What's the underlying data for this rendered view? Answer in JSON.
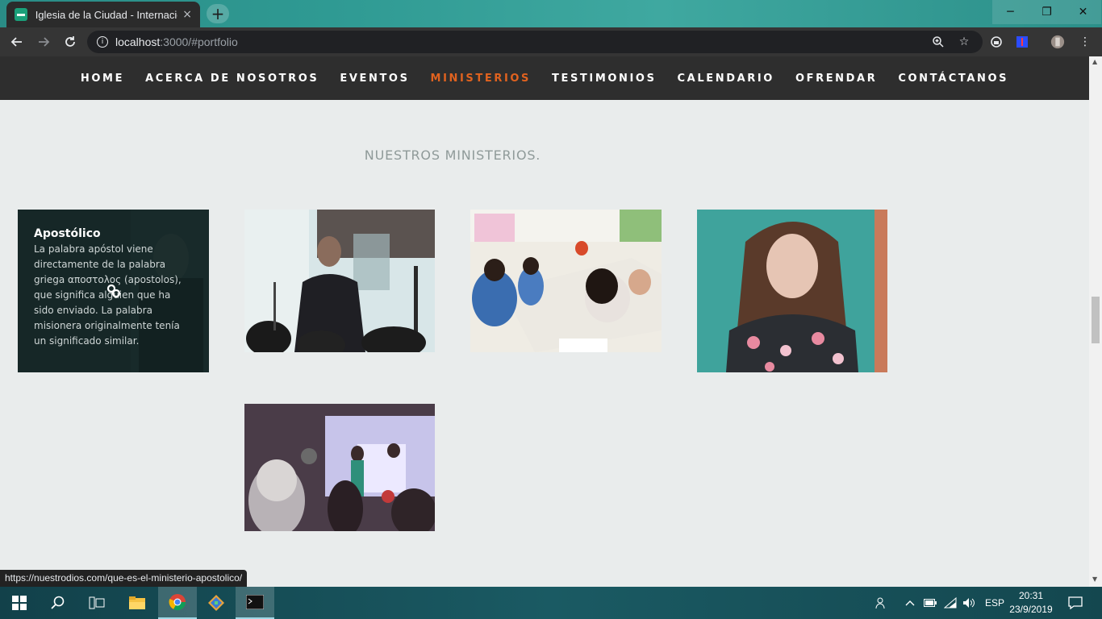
{
  "browser": {
    "tab_title": "Iglesia de la Ciudad - Internacional",
    "close_tab": "×",
    "new_tab": "+",
    "url_host": "localhost",
    "url_rest": ":3000/#portfolio",
    "status_url": "https://nuestrodios.com/que-es-el-ministerio-apostolico/",
    "window_controls": {
      "minimize": "─",
      "restore": "❐",
      "close": "✕"
    }
  },
  "nav": {
    "items": [
      {
        "label": "HOME"
      },
      {
        "label": "ACERCA DE NOSOTROS"
      },
      {
        "label": "EVENTOS"
      },
      {
        "label": "MINISTERIOS"
      },
      {
        "label": "TESTIMONIOS"
      },
      {
        "label": "CALENDARIO"
      },
      {
        "label": "OFRENDAR"
      },
      {
        "label": "CONTÁCTANOS"
      }
    ],
    "active": "MINISTERIOS",
    "active_color": "#e0621f"
  },
  "section": {
    "title": "NUESTROS MINISTERIOS."
  },
  "portfolio": {
    "featured": {
      "title": "Apostólico",
      "text": "La palabra apóstol viene directamente de la palabra griega αποστολος (apostolos), que significa alguien que ha sido enviado. La palabra misionera originalmente tenía un significado similar."
    }
  },
  "taskbar": {
    "language": "ESP",
    "time": "20:31",
    "date": "23/9/2019"
  }
}
